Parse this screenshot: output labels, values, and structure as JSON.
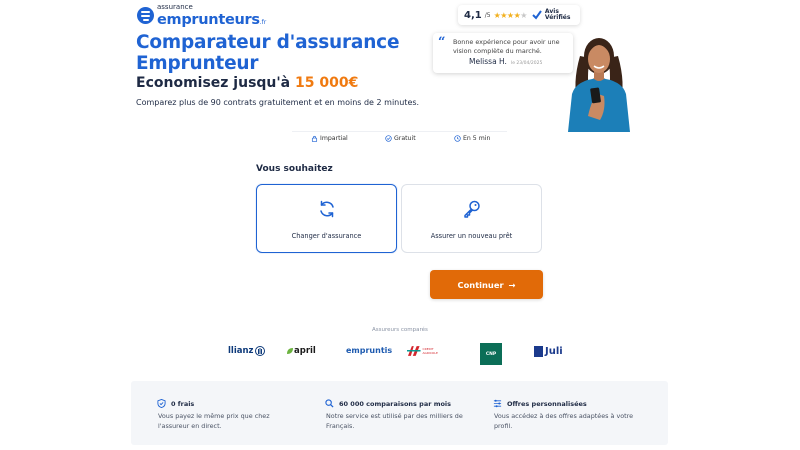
{
  "header": {
    "logo_small": "assurance",
    "logo_big": "emprunteurs",
    "logo_tld": ".fr",
    "rating_score": "4,1",
    "rating_max": "/5",
    "rating_stars_full": 4,
    "rating_stars_total": 5,
    "rating_source": "Avis Vérifiés"
  },
  "hero": {
    "headline": "Comparateur d'assurance Emprunteur",
    "subhead_prefix": "Economisez jusqu'à ",
    "subhead_amount": "15 000€",
    "lead": "Comparez plus de 90 contrats gratuitement et en moins de 2 minutes."
  },
  "testimonial": {
    "quote": "Bonne expérience pour avoir une vision complète du marché.",
    "author": "Melissa H.",
    "date": "le 23/04/2025"
  },
  "features": [
    {
      "label": "Impartial",
      "icon": "lock-icon"
    },
    {
      "label": "Gratuit",
      "icon": "check-circle-icon"
    },
    {
      "label": "En 5 min",
      "icon": "clock-icon"
    }
  ],
  "form": {
    "question": "Vous souhaitez",
    "choices": [
      {
        "label": "Changer d'assurance",
        "icon": "refresh-icon",
        "selected": true
      },
      {
        "label": "Assurer un nouveau prêt",
        "icon": "key-icon",
        "selected": false
      }
    ],
    "continue_label": "Continuer",
    "continue_arrow": "→"
  },
  "insurers": {
    "title": "Assureurs comparés",
    "items": [
      "llianz",
      "april",
      "empruntis",
      "CREDIT AGRICOLE",
      "CNP",
      "Juli"
    ]
  },
  "benefits": [
    {
      "title": "0 frais",
      "text": "Vous payez le même prix que chez l'assureur en direct.",
      "icon": "shield-icon"
    },
    {
      "title": "60 000 comparaisons par mois",
      "text": "Notre service est utilisé par des milliers de Français.",
      "icon": "search-icon"
    },
    {
      "title": "Offres personnalisées",
      "text": "Vous accédez à des offres adaptées à votre profil.",
      "icon": "sliders-icon"
    }
  ],
  "colors": {
    "brand_blue": "#1f63d3",
    "accent_orange": "#e16a08",
    "amount_orange": "#f07a10",
    "text_dark": "#1e2a44"
  }
}
